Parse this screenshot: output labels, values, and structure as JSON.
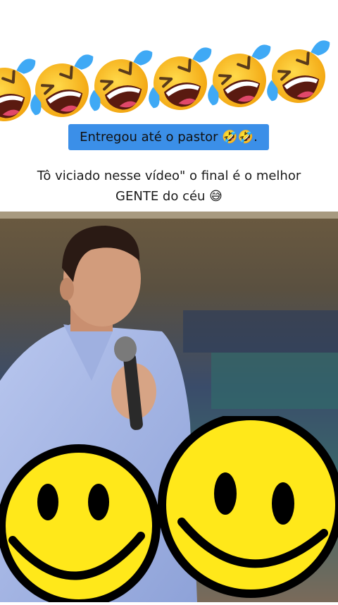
{
  "caption": {
    "text": "Entregou até o pastor",
    "emojis": "🤣🤣.",
    "background_color": "#3b8fe8"
  },
  "description": {
    "line1": "Tô viciado nesse vídeo\" o final é o melhor",
    "line2": "GENTE do céu 😅"
  },
  "decorations": {
    "top_row": [
      "rolling-on-floor-laughing-icon",
      "rolling-on-floor-laughing-icon",
      "rolling-on-floor-laughing-icon",
      "rolling-on-floor-laughing-icon",
      "rolling-on-floor-laughing-icon",
      "rolling-on-floor-laughing-icon"
    ],
    "bottom_overlay": [
      "smiley-face-icon",
      "smiley-face-icon"
    ]
  }
}
